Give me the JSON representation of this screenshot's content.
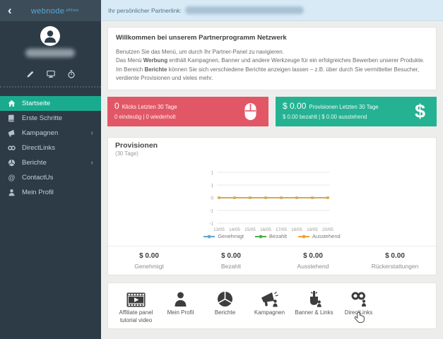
{
  "sidebar": {
    "logo": {
      "brand": "webnode",
      "suffix": "affiliate"
    },
    "back_glyph": "‹",
    "menu": [
      {
        "label": "Startseite",
        "icon": "home",
        "active": true,
        "has_submenu": false
      },
      {
        "label": "Erste Schritte",
        "icon": "book",
        "active": false,
        "has_submenu": false
      },
      {
        "label": "Kampagnen",
        "icon": "megaphone",
        "active": false,
        "has_submenu": true
      },
      {
        "label": "DirectLinks",
        "icon": "chain-link",
        "active": false,
        "has_submenu": false
      },
      {
        "label": "Berichte",
        "icon": "pie-chart",
        "active": false,
        "has_submenu": true
      },
      {
        "label": "ContactUs",
        "icon": "at-sign",
        "active": false,
        "has_submenu": false
      },
      {
        "label": "Mein Profil",
        "icon": "user",
        "active": false,
        "has_submenu": false
      }
    ],
    "submenu_chevron": "‹",
    "tool_icons": [
      "pencil-icon",
      "monitor-icon",
      "stopwatch-icon"
    ]
  },
  "topbar": {
    "partner_link_label": "Ihr persönlicher Partnerlink:"
  },
  "welcome": {
    "title": "Willkommen bei unserem Partnerprogramm Netzwerk",
    "line1": "Benutzen Sie das Menü, um durch Ihr Partner-Panel zu navigieren.",
    "line2_pre": "Das Menü ",
    "line2_bold": "Werbung",
    "line2_post": " enthält Kampagnen, Banner und andere Werkzeuge für ein erfolgreiches Bewerben unserer Produkte.",
    "line3_pre": "Im Bereich ",
    "line3_bold": "Berichte",
    "line3_post": " können Sie sich verschiedene Berichte anzeigen lassen – z.B. über durch Sie vermittelter Besucher, verdiente Provisionen und vieles mehr."
  },
  "stat_cards": {
    "clicks": {
      "value": "0",
      "label": "Klicks Letzten 30 Tage",
      "sub": "0 eindeutig | 0 wiederholt",
      "color": "#e25766",
      "icon": "mouse-icon"
    },
    "commissions": {
      "value": "$ 0.00",
      "label": "Provisionen Letzten 30 Tage",
      "sub": "$ 0.00 bezahlt | $ 0.00 ausstehend",
      "color": "#24b292",
      "icon": "dollar-icon",
      "dollar_glyph": "$"
    }
  },
  "chart_data": {
    "type": "line",
    "title": "Provisionen",
    "subtitle": "(30 Tage)",
    "x": [
      "13/05",
      "14/05",
      "15/05",
      "16/05",
      "17/05",
      "18/05",
      "19/05",
      "20/05"
    ],
    "y_tick_labels": [
      "1",
      "1",
      "0",
      "-1",
      "-1"
    ],
    "ylim": [
      -1,
      1
    ],
    "grid": true,
    "legend_position": "bottom",
    "series": [
      {
        "name": "Genehmigt",
        "color": "#64a8d1",
        "values": [
          0,
          0,
          0,
          0,
          0,
          0,
          0,
          0
        ]
      },
      {
        "name": "Bezahlt",
        "color": "#4cae4c",
        "values": [
          0,
          0,
          0,
          0,
          0,
          0,
          0,
          0
        ]
      },
      {
        "name": "Ausstehend",
        "color": "#eda13c",
        "values": [
          0,
          0,
          0,
          0,
          0,
          0,
          0,
          0
        ]
      }
    ]
  },
  "summary": [
    {
      "value": "$ 0.00",
      "label": "Genehmigt"
    },
    {
      "value": "$ 0.00",
      "label": "Bezahlt"
    },
    {
      "value": "$ 0.00",
      "label": "Ausstehend"
    },
    {
      "value": "$ 0.00",
      "label": "Rückerstattungen"
    }
  ],
  "shortcuts": [
    {
      "label": "Affiliate panel tutorial video",
      "icon": "film-video-icon"
    },
    {
      "label": "Mein Profil",
      "icon": "user-icon"
    },
    {
      "label": "Berichte",
      "icon": "pie-chart-icon"
    },
    {
      "label": "Kampagnen",
      "icon": "megaphone-icon"
    },
    {
      "label": "Banner & Links",
      "icon": "click-hand-icon"
    },
    {
      "label": "DirectLinks",
      "icon": "chain-links-icon"
    }
  ],
  "colors": {
    "sidebar_bg": "#2c3b46",
    "sidebar_header_bg": "#3c4d59",
    "brand_blue": "#58a7d8",
    "active_green": "#1aab8e",
    "topbar_bg": "#d8eaf6",
    "card_red": "#e25766",
    "card_green": "#24b292",
    "main_bg": "#edeeec"
  }
}
